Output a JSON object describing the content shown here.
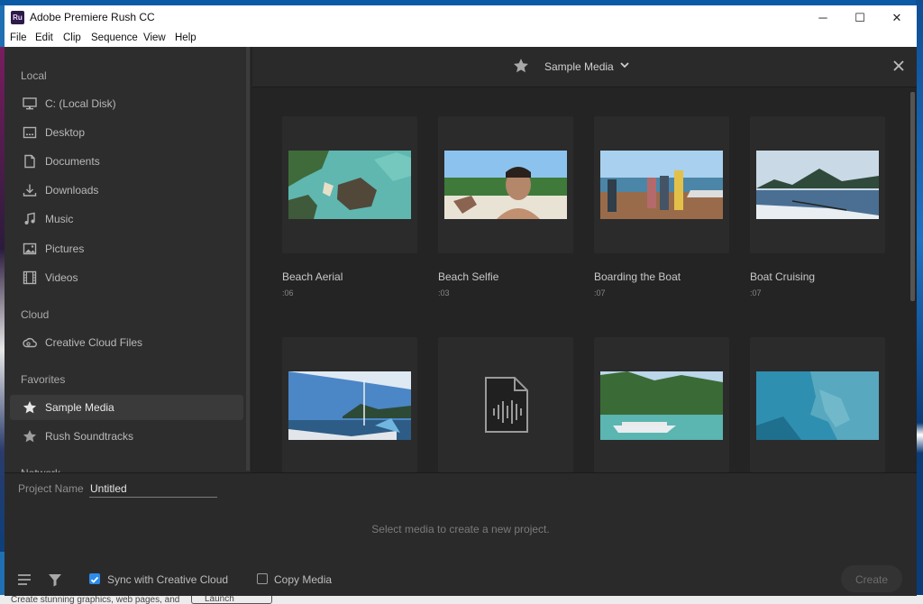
{
  "window": {
    "title": "Adobe Premiere Rush CC",
    "logo_text": "Ru",
    "controls": {
      "minimize": "─",
      "maximize": "☐",
      "close": "✕"
    }
  },
  "menu": [
    "File",
    "Edit",
    "Clip",
    "Sequence",
    "View",
    "Help"
  ],
  "sidebar": {
    "sections": {
      "local": "Local",
      "cloud": "Cloud",
      "favorites": "Favorites",
      "network": "Network"
    },
    "local_items": [
      {
        "label": "C: (Local Disk)",
        "icon": "monitor-icon"
      },
      {
        "label": "Desktop",
        "icon": "desktop-icon"
      },
      {
        "label": "Documents",
        "icon": "document-icon"
      },
      {
        "label": "Downloads",
        "icon": "download-icon"
      },
      {
        "label": "Music",
        "icon": "music-icon"
      },
      {
        "label": "Pictures",
        "icon": "image-icon"
      },
      {
        "label": "Videos",
        "icon": "film-icon"
      }
    ],
    "cloud_items": [
      {
        "label": "Creative Cloud Files",
        "icon": "creative-cloud-icon"
      }
    ],
    "favorite_items": [
      {
        "label": "Sample Media",
        "icon": "star-icon",
        "active": true
      },
      {
        "label": "Rush Soundtracks",
        "icon": "star-icon",
        "active": false
      }
    ]
  },
  "browser": {
    "title": "Sample Media",
    "items": [
      {
        "name": "Beach Aerial",
        "duration": ":06"
      },
      {
        "name": "Beach Selfie",
        "duration": ":03"
      },
      {
        "name": "Boarding the Boat",
        "duration": ":07"
      },
      {
        "name": "Boat Cruising",
        "duration": ":07"
      }
    ]
  },
  "project": {
    "name_label": "Project Name",
    "name_value": "Untitled",
    "hint": "Select media to create a new project.",
    "sync_label": "Sync with Creative Cloud",
    "sync_checked": true,
    "copy_label": "Copy Media",
    "copy_checked": false,
    "create_label": "Create"
  },
  "desktop": {
    "taskbar_text": "Create stunning graphics, web pages, and",
    "taskbar_button": "Launch"
  },
  "colors": {
    "accent": "#2d8ceb",
    "panel": "#2d2d2d",
    "background": "#232323"
  }
}
